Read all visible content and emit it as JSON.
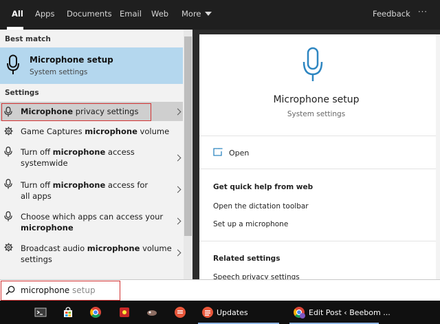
{
  "tabs": [
    {
      "label": "All",
      "active": true
    },
    {
      "label": "Apps"
    },
    {
      "label": "Documents"
    },
    {
      "label": "Email"
    },
    {
      "label": "Web"
    },
    {
      "label": "More"
    }
  ],
  "header": {
    "feedback": "Feedback",
    "more_options": "···"
  },
  "left": {
    "best_match_label": "Best match",
    "best_match": {
      "title": "Microphone setup",
      "subtitle": "System settings",
      "icon": "microphone-icon"
    },
    "settings_label": "Settings",
    "items": [
      {
        "pre": "",
        "bold": "Microphone",
        "post": " privacy settings",
        "icon": "microphone-icon"
      },
      {
        "pre": "Game Captures ",
        "bold": "microphone",
        "post": " volume",
        "icon": "gear-icon"
      },
      {
        "pre": "Turn off ",
        "bold": "microphone",
        "post": " access systemwide",
        "icon": "microphone-icon"
      },
      {
        "pre": "Turn off ",
        "bold": "microphone",
        "post": " access for all apps",
        "icon": "microphone-icon"
      },
      {
        "pre": "Choose which apps can access your ",
        "bold": "microphone",
        "post": "",
        "icon": "microphone-icon"
      },
      {
        "pre": "Broadcast audio ",
        "bold": "microphone",
        "post": " volume settings",
        "icon": "gear-icon"
      }
    ]
  },
  "right": {
    "title": "Microphone setup",
    "subtitle": "System settings",
    "open_label": "Open",
    "quick_help_heading": "Get quick help from web",
    "quick_help_links": [
      "Open the dictation toolbar",
      "Set up a microphone"
    ],
    "related_heading": "Related settings",
    "related_links": [
      "Speech privacy settings"
    ]
  },
  "search": {
    "typed": "microphone",
    "suggestion": " setup"
  },
  "taskbar": {
    "items": [
      {
        "icon": "terminal-icon"
      },
      {
        "icon": "store-icon"
      },
      {
        "icon": "chrome-icon"
      },
      {
        "icon": "browser-icon"
      },
      {
        "icon": "game-icon"
      },
      {
        "icon": "app-icon"
      },
      {
        "icon": "todoist-icon"
      },
      {
        "icon": "updates-icon",
        "label": "Updates"
      },
      {
        "icon": "chrome-profile-icon",
        "label": "Edit Post ‹ Beebom ..."
      }
    ]
  },
  "colors": {
    "accent": "#2e86c1",
    "selection": "#b4d7ee",
    "highlight_border": "#d23131",
    "taskbar": "#101010"
  }
}
